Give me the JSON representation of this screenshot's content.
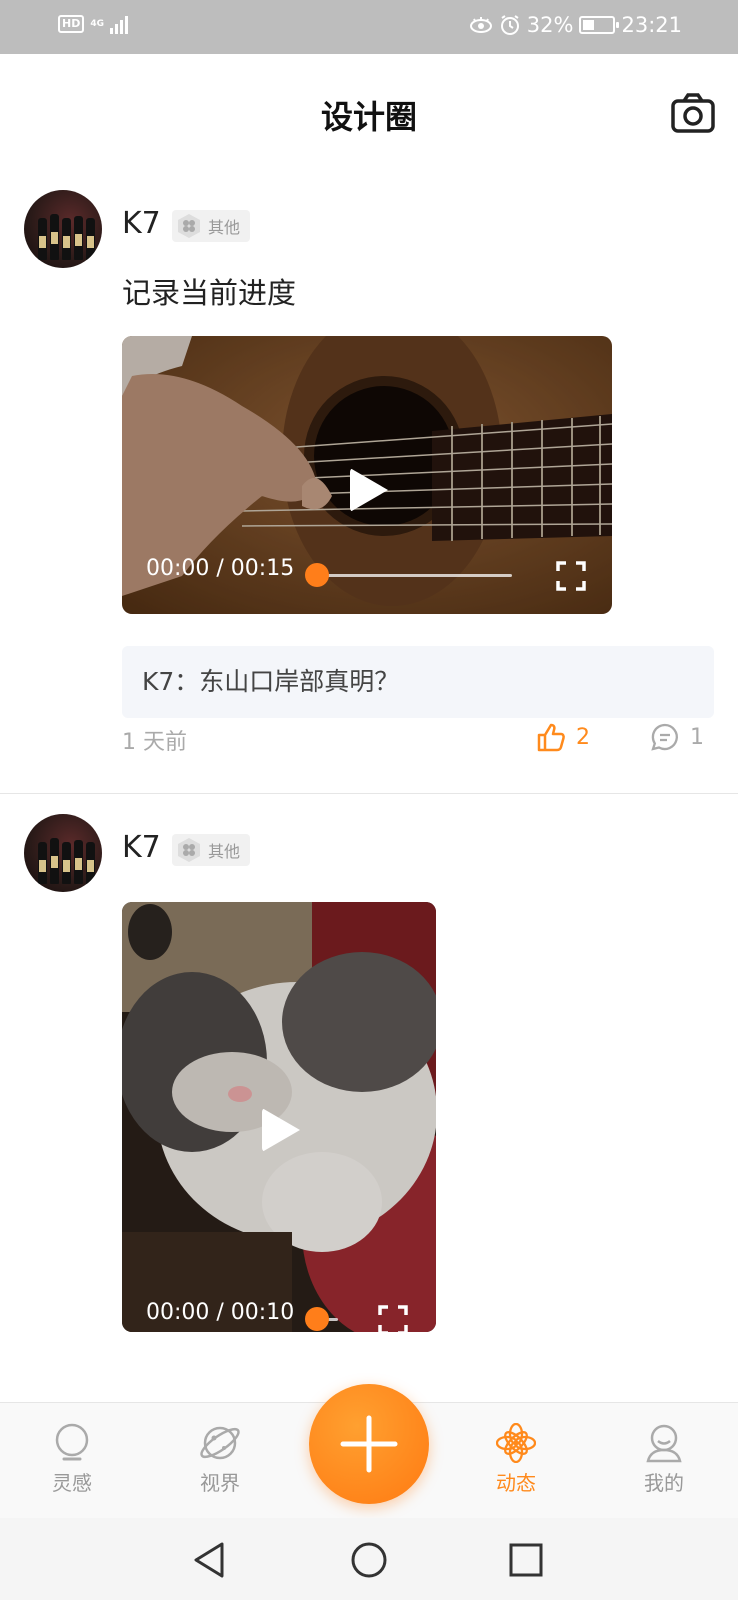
{
  "status_bar": {
    "hd": "HD",
    "network": "4G",
    "battery_percent": "32%",
    "time": "23:21",
    "icons": [
      "eye-icon",
      "alarm-icon",
      "battery-icon"
    ]
  },
  "header": {
    "title": "设计圈",
    "camera_icon": "camera-icon"
  },
  "posts": [
    {
      "username": "K7",
      "category": "其他",
      "text": "记录当前进度",
      "video": {
        "time": "00:00 / 00:15",
        "progress": 0.0
      },
      "comment": "K7：东山口岸部真明？",
      "time_ago": "1 天前",
      "likes": "2",
      "comments": "1"
    },
    {
      "username": "K7",
      "category": "其他",
      "video": {
        "time": "00:00 / 00:10",
        "progress": 0.0
      }
    }
  ],
  "tabbar": {
    "tabs": [
      {
        "label": "灵感",
        "icon": "bulb-icon"
      },
      {
        "label": "视界",
        "icon": "planet-icon"
      },
      {
        "label": "动态",
        "icon": "flower-icon",
        "active": true
      },
      {
        "label": "我的",
        "icon": "user-icon"
      }
    ],
    "fab_icon": "plus-icon"
  },
  "colors": {
    "accent": "#ff8a1c",
    "status_bar": "#bdbdbd"
  }
}
